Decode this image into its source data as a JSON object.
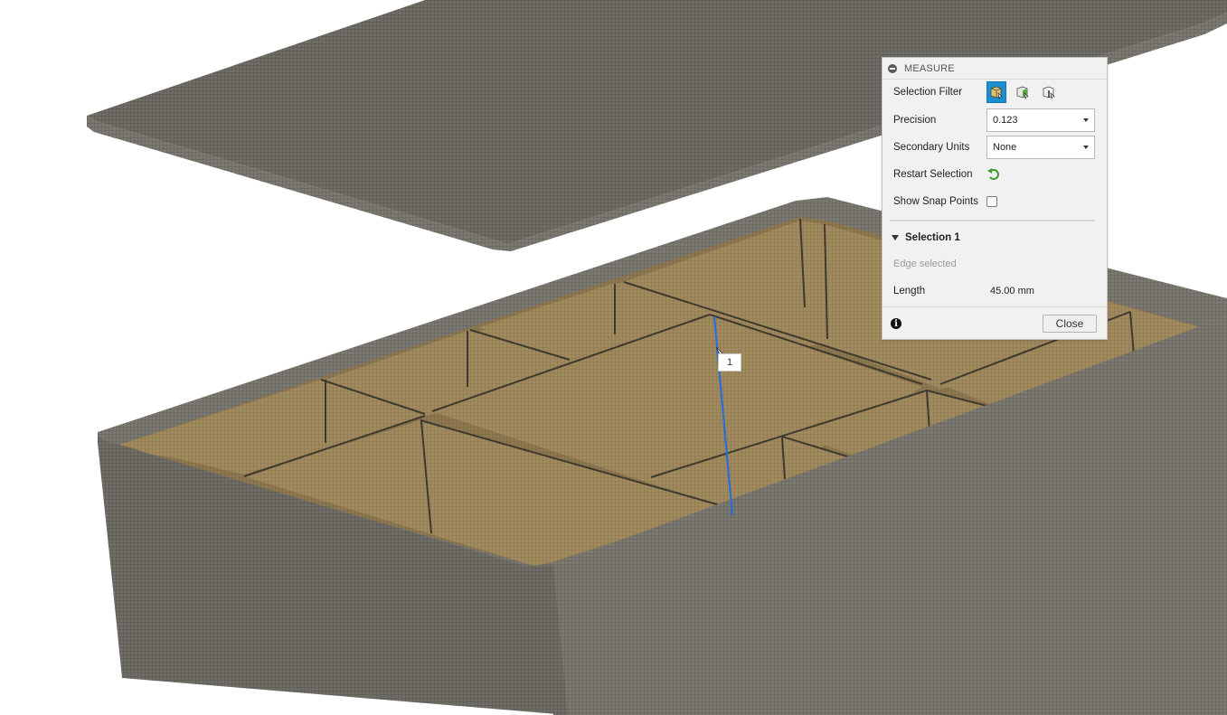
{
  "measure_panel": {
    "title": "MEASURE",
    "selection_filter_label": "Selection Filter",
    "filter_buttons": [
      "body-filter-icon",
      "face-filter-icon",
      "edge-filter-icon"
    ],
    "active_filter": "body-filter-icon",
    "precision_label": "Precision",
    "precision_value": "0.123",
    "secondary_units_label": "Secondary Units",
    "secondary_units_value": "None",
    "restart_selection_label": "Restart Selection",
    "show_snap_points_label": "Show Snap Points",
    "show_snap_points_checked": false,
    "section_title": "Selection 1",
    "edge_status": "Edge selected",
    "length_label": "Length",
    "length_value": "45.00 mm",
    "close_label": "Close"
  },
  "viewport": {
    "selection_marker": "1",
    "colors": {
      "selection_blue": "#1d8ed1",
      "measured_edge": "#2a6fd6",
      "restart_green": "#3f9a2f",
      "lid_top": "#6d6b63",
      "wood_interior": "#9b8558",
      "box_wall": "#6a6963"
    }
  }
}
